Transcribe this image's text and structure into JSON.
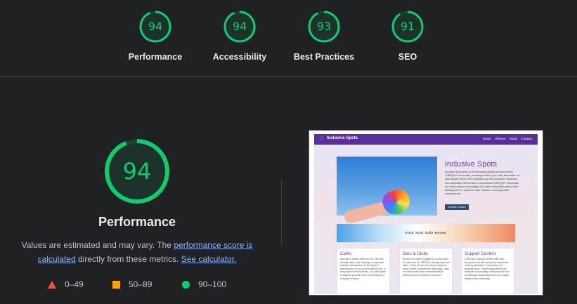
{
  "categories": [
    {
      "label": "Performance",
      "score": 94
    },
    {
      "label": "Accessibility",
      "score": 94
    },
    {
      "label": "Best Practices",
      "score": 93
    },
    {
      "label": "SEO",
      "score": 91
    }
  ],
  "main": {
    "score": "94",
    "score_value": 94,
    "title": "Performance",
    "desc_prefix": "Values are estimated and may vary. The ",
    "link_score": "performance score is calculated",
    "desc_middle": " directly from these metrics. ",
    "link_calc": "See calculator."
  },
  "legend": [
    {
      "range": "0–49",
      "icon": "red-triangle-icon",
      "color": "#ff4e42"
    },
    {
      "range": "50–89",
      "icon": "orange-square-icon",
      "color": "#ffa400"
    },
    {
      "range": "90–100",
      "icon": "green-circle-icon",
      "color": "#0cce6b"
    }
  ],
  "colors": {
    "pass": "#0cce6b",
    "background": "#202124",
    "link": "#8ab4f8"
  },
  "thumbnail": {
    "brand": "Inclusive Spots",
    "nav_links": [
      "Home",
      "Venues",
      "About",
      "Contact"
    ],
    "hero_title": "Inclusive Spots",
    "hero_text": "Inclusive Spots aims to be the leading global resource for the LGBTQIA+ community, providing trusted, up-to-date information on safe spaces where every individual can feel accepted, respected, and celebrated. We envision a world where LGBTQIA+ individuals can freely explore and engage with their communities without fear, knowing there is access to safe, inclusive, and supportive environments.",
    "hero_button": "Explore venues",
    "banner_text": "Find Your Safe Haven",
    "cards": [
      {
        "title": "Cafés",
        "text": "Discover a vibrant selection of LGBTQIA+ friendly cafés, each offering a unique and inclusive atmosphere for all. If you're searching for a cozy spot to read a book, a lively place to meet friends, or a safe space to express yourself, there is something for everyone to enjoy."
      },
      {
        "title": "Bars & Clubs",
        "text": "Explore the vibrant nightlife of London with our selection of LGBTQIA+ friendly bars and clubs. These venues are not just places to enjoy a drink or dance the night away—they are community hubs where diversity is celebrated and everyone is welcome."
      },
      {
        "title": "Support Centers",
        "text": "LGBTQIA+ support centers offer vital resources and safe spaces for individuals seeking assistance, community, and empowerment. These organizations are dedicated to providing compassionate and professional support tailored to the unique needs of the community."
      }
    ]
  }
}
